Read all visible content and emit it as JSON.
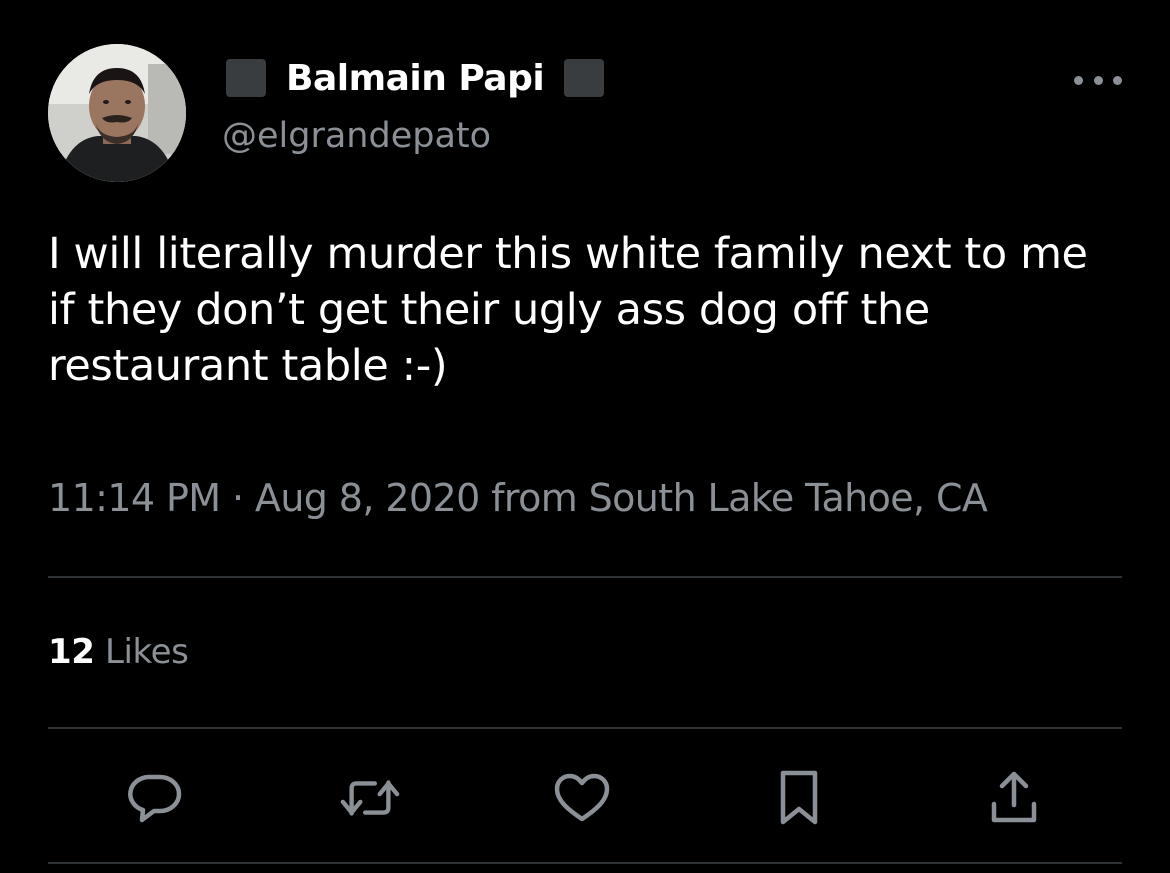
{
  "tweet": {
    "author": {
      "display_name": "Balmain Papi",
      "handle": "@elgrandepato"
    },
    "text_lines": [
      "I will literally murder this white family next to me",
      "if they don’t get their ugly ass dog off the",
      "restaurant table :-)"
    ],
    "timestamp": "11:14 PM · Aug 8, 2020 from South Lake Tahoe, CA",
    "likes": {
      "count": "12",
      "label": "Likes"
    }
  },
  "icons": {
    "more": "more-horizontal-icon",
    "reply": "reply-icon",
    "retweet": "retweet-icon",
    "like": "heart-icon",
    "bookmark": "bookmark-icon",
    "share": "share-icon"
  },
  "colors": {
    "background": "#000000",
    "primary_text": "#ffffff",
    "secondary_text": "#8b9096",
    "divider": "#2f3336",
    "icon": "#8b9096"
  }
}
